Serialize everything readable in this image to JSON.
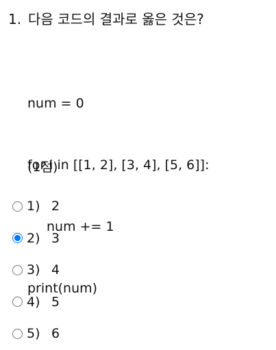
{
  "question": {
    "number": "1.",
    "text": "다음 코드의 결과로 옳은 것은?"
  },
  "code": {
    "lines": [
      "num = 0",
      "for i in [[1, 2], [3, 4], [5, 6]]:",
      "num += 1",
      "print(num)"
    ]
  },
  "points": "(1점)",
  "options": [
    {
      "label": "1)",
      "value": "2",
      "checked": false
    },
    {
      "label": "2)",
      "value": "3",
      "checked": true
    },
    {
      "label": "3)",
      "value": "4",
      "checked": false
    },
    {
      "label": "4)",
      "value": "5",
      "checked": false
    },
    {
      "label": "5)",
      "value": "6",
      "checked": false
    }
  ],
  "colors": {
    "radio_checked": "#0075ff",
    "radio_border": "#767676"
  }
}
